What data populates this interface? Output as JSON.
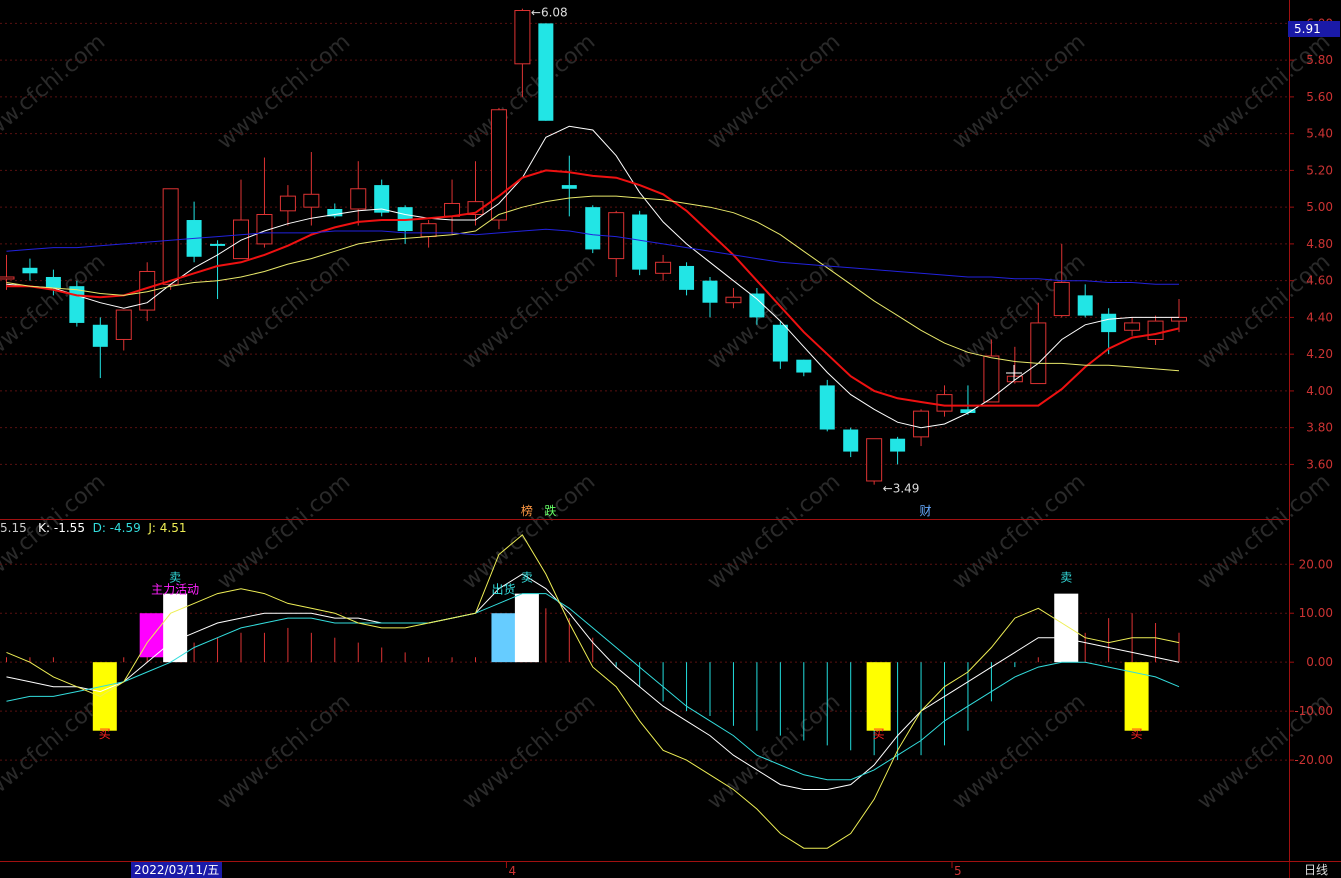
{
  "chart_data": [
    {
      "type": "candlestick",
      "panel": "main",
      "ylim": [
        3.45,
        6.1
      ],
      "y_ticks": [
        "6.00",
        "5.80",
        "5.60",
        "5.40",
        "5.20",
        "5.00",
        "4.80",
        "4.60",
        "4.40",
        "4.20",
        "4.00",
        "3.80",
        "3.60"
      ],
      "last_price": "5.91",
      "candles": [
        {
          "o": 4.62,
          "h": 4.74,
          "l": 4.55,
          "c": 4.62
        },
        {
          "o": 4.67,
          "h": 4.72,
          "l": 4.6,
          "c": 4.64
        },
        {
          "o": 4.62,
          "h": 4.66,
          "l": 4.52,
          "c": 4.56
        },
        {
          "o": 4.57,
          "h": 4.6,
          "l": 4.35,
          "c": 4.37
        },
        {
          "o": 4.36,
          "h": 4.4,
          "l": 4.07,
          "c": 4.24
        },
        {
          "o": 4.28,
          "h": 4.44,
          "l": 4.22,
          "c": 4.44
        },
        {
          "o": 4.44,
          "h": 4.7,
          "l": 4.38,
          "c": 4.65
        },
        {
          "o": 4.58,
          "h": 5.1,
          "l": 4.55,
          "c": 5.1
        },
        {
          "o": 4.93,
          "h": 5.03,
          "l": 4.7,
          "c": 4.73
        },
        {
          "o": 4.8,
          "h": 4.82,
          "l": 4.5,
          "c": 4.79
        },
        {
          "o": 4.72,
          "h": 5.15,
          "l": 4.72,
          "c": 4.93
        },
        {
          "o": 4.8,
          "h": 5.27,
          "l": 4.78,
          "c": 4.96
        },
        {
          "o": 4.98,
          "h": 5.12,
          "l": 4.9,
          "c": 5.06
        },
        {
          "o": 5.0,
          "h": 5.3,
          "l": 4.9,
          "c": 5.07
        },
        {
          "o": 4.99,
          "h": 5.02,
          "l": 4.94,
          "c": 4.95
        },
        {
          "o": 4.99,
          "h": 5.25,
          "l": 4.9,
          "c": 5.1
        },
        {
          "o": 5.12,
          "h": 5.15,
          "l": 4.95,
          "c": 4.97
        },
        {
          "o": 5.0,
          "h": 5.01,
          "l": 4.8,
          "c": 4.87
        },
        {
          "o": 4.84,
          "h": 4.93,
          "l": 4.78,
          "c": 4.91
        },
        {
          "o": 4.95,
          "h": 5.15,
          "l": 4.85,
          "c": 5.02
        },
        {
          "o": 4.96,
          "h": 5.25,
          "l": 4.9,
          "c": 5.03
        },
        {
          "o": 4.93,
          "h": 5.54,
          "l": 4.88,
          "c": 5.53
        },
        {
          "o": 5.78,
          "h": 6.08,
          "l": 5.6,
          "c": 6.07
        },
        {
          "o": 6.0,
          "h": 6.0,
          "l": 5.47,
          "c": 5.47
        },
        {
          "o": 5.12,
          "h": 5.28,
          "l": 4.95,
          "c": 5.1
        },
        {
          "o": 5.0,
          "h": 5.01,
          "l": 4.75,
          "c": 4.77
        },
        {
          "o": 4.72,
          "h": 4.98,
          "l": 4.62,
          "c": 4.97
        },
        {
          "o": 4.96,
          "h": 4.98,
          "l": 4.63,
          "c": 4.66
        },
        {
          "o": 4.64,
          "h": 4.74,
          "l": 4.6,
          "c": 4.7
        },
        {
          "o": 4.68,
          "h": 4.7,
          "l": 4.52,
          "c": 4.55
        },
        {
          "o": 4.6,
          "h": 4.62,
          "l": 4.4,
          "c": 4.48
        },
        {
          "o": 4.48,
          "h": 4.56,
          "l": 4.45,
          "c": 4.51
        },
        {
          "o": 4.53,
          "h": 4.56,
          "l": 4.36,
          "c": 4.4
        },
        {
          "o": 4.36,
          "h": 4.38,
          "l": 4.12,
          "c": 4.16
        },
        {
          "o": 4.17,
          "h": 4.17,
          "l": 4.08,
          "c": 4.1
        },
        {
          "o": 4.03,
          "h": 4.06,
          "l": 3.78,
          "c": 3.79
        },
        {
          "o": 3.79,
          "h": 3.8,
          "l": 3.64,
          "c": 3.67
        },
        {
          "o": 3.51,
          "h": 3.74,
          "l": 3.49,
          "c": 3.74
        },
        {
          "o": 3.74,
          "h": 3.75,
          "l": 3.6,
          "c": 3.67
        },
        {
          "o": 3.75,
          "h": 3.9,
          "l": 3.7,
          "c": 3.89
        },
        {
          "o": 3.89,
          "h": 4.03,
          "l": 3.86,
          "c": 3.98
        },
        {
          "o": 3.9,
          "h": 4.03,
          "l": 3.87,
          "c": 3.88
        },
        {
          "o": 3.94,
          "h": 4.28,
          "l": 3.94,
          "c": 4.19
        },
        {
          "o": 4.05,
          "h": 4.24,
          "l": 4.04,
          "c": 4.08
        },
        {
          "o": 4.04,
          "h": 4.48,
          "l": 4.04,
          "c": 4.37
        },
        {
          "o": 4.41,
          "h": 4.8,
          "l": 4.4,
          "c": 4.59
        },
        {
          "o": 4.52,
          "h": 4.58,
          "l": 4.4,
          "c": 4.41
        },
        {
          "o": 4.42,
          "h": 4.45,
          "l": 4.2,
          "c": 4.32
        },
        {
          "o": 4.33,
          "h": 4.4,
          "l": 4.3,
          "c": 4.37
        },
        {
          "o": 4.28,
          "h": 4.41,
          "l": 4.25,
          "c": 4.38
        },
        {
          "o": 4.38,
          "h": 4.5,
          "l": 4.32,
          "c": 4.4
        }
      ],
      "lines": [
        {
          "name": "ma_white",
          "color": "#ffffff",
          "width": 1,
          "values": [
            4.58,
            4.57,
            4.56,
            4.52,
            4.48,
            4.45,
            4.48,
            4.58,
            4.67,
            4.74,
            4.82,
            4.87,
            4.91,
            4.94,
            4.96,
            4.98,
            4.99,
            4.96,
            4.94,
            4.93,
            4.93,
            5.02,
            5.16,
            5.38,
            5.44,
            5.42,
            5.28,
            5.08,
            4.92,
            4.8,
            4.7,
            4.6,
            4.5,
            4.38,
            4.24,
            4.1,
            3.98,
            3.9,
            3.83,
            3.8,
            3.82,
            3.88,
            3.96,
            4.06,
            4.15,
            4.28,
            4.36,
            4.39,
            4.4,
            4.4,
            4.4
          ]
        },
        {
          "name": "ma_red",
          "color": "#ee1111",
          "width": 2,
          "values": [
            4.57,
            4.57,
            4.55,
            4.52,
            4.51,
            4.52,
            4.56,
            4.6,
            4.64,
            4.68,
            4.7,
            4.74,
            4.79,
            4.85,
            4.89,
            4.92,
            4.93,
            4.93,
            4.94,
            4.95,
            4.97,
            5.06,
            5.16,
            5.2,
            5.19,
            5.17,
            5.16,
            5.12,
            5.07,
            4.98,
            4.86,
            4.74,
            4.6,
            4.46,
            4.32,
            4.2,
            4.08,
            4.0,
            3.96,
            3.94,
            3.92,
            3.92,
            3.92,
            3.92,
            3.92,
            4.01,
            4.13,
            4.23,
            4.29,
            4.31,
            4.34
          ]
        },
        {
          "name": "ma_yellow",
          "color": "#e8e86a",
          "width": 1,
          "values": [
            4.59,
            4.57,
            4.56,
            4.55,
            4.53,
            4.52,
            4.54,
            4.57,
            4.59,
            4.6,
            4.62,
            4.65,
            4.69,
            4.72,
            4.76,
            4.8,
            4.82,
            4.83,
            4.84,
            4.85,
            4.87,
            4.96,
            5.0,
            5.03,
            5.05,
            5.06,
            5.06,
            5.05,
            5.04,
            5.02,
            5.0,
            4.97,
            4.92,
            4.85,
            4.76,
            4.67,
            4.58,
            4.49,
            4.41,
            4.33,
            4.26,
            4.21,
            4.18,
            4.16,
            4.15,
            4.15,
            4.14,
            4.14,
            4.13,
            4.12,
            4.11
          ]
        },
        {
          "name": "ma_blue",
          "color": "#2222dd",
          "width": 1,
          "values": [
            4.76,
            4.77,
            4.78,
            4.78,
            4.79,
            4.8,
            4.81,
            4.82,
            4.83,
            4.84,
            4.85,
            4.86,
            4.86,
            4.86,
            4.87,
            4.87,
            4.87,
            4.86,
            4.86,
            4.86,
            4.85,
            4.86,
            4.87,
            4.88,
            4.87,
            4.85,
            4.84,
            4.82,
            4.8,
            4.78,
            4.76,
            4.74,
            4.72,
            4.7,
            4.69,
            4.68,
            4.67,
            4.66,
            4.65,
            4.64,
            4.63,
            4.62,
            4.62,
            4.61,
            4.61,
            4.6,
            4.6,
            4.59,
            4.59,
            4.58,
            4.58
          ]
        }
      ],
      "annotations": [
        {
          "label": "6.08",
          "kind": "high",
          "index": 22,
          "value": 6.08
        },
        {
          "label": "3.49",
          "kind": "low",
          "index": 37,
          "value": 3.49
        }
      ],
      "event_markers": [
        {
          "label": "榜",
          "index": 22,
          "color": "#ff9944"
        },
        {
          "label": "跌",
          "index": 23,
          "color": "#66ff66"
        },
        {
          "label": "财",
          "index": 39,
          "color": "#66aaff"
        }
      ]
    },
    {
      "type": "indicator",
      "panel": "kdj",
      "ylim": [
        -40,
        27
      ],
      "y_ticks": [
        "20.00",
        "10.00",
        "0.00",
        "-10.00",
        "-20.00"
      ],
      "legend": [
        {
          "text": "5.15",
          "color": "#cccccc"
        },
        {
          "text": "K: -1.55",
          "color": "#ffffff"
        },
        {
          "text": "D: -4.59",
          "color": "#33dddd"
        },
        {
          "text": "J: 4.51",
          "color": "#eeee55"
        }
      ],
      "histogram": [
        1,
        1,
        1,
        0,
        0,
        1,
        2,
        3,
        4,
        5,
        6,
        6,
        7,
        6,
        5,
        4,
        3,
        2,
        1,
        1,
        1,
        2,
        8,
        11,
        9,
        5,
        -1,
        -5,
        -8,
        -10,
        -11,
        -13,
        -14,
        -15,
        -16,
        -17,
        -18,
        -19,
        -20,
        -19,
        -17,
        -14,
        -8,
        -1,
        1,
        3,
        6,
        9,
        10,
        8,
        6
      ],
      "lines": [
        {
          "name": "K",
          "color": "#ffffff",
          "values": [
            -3,
            -4,
            -5,
            -5,
            -6,
            -4,
            0,
            4,
            6,
            8,
            9,
            10,
            10,
            10,
            9,
            9,
            8,
            8,
            8,
            9,
            10,
            15,
            18,
            15,
            10,
            4,
            -1,
            -5,
            -9,
            -12,
            -15,
            -19,
            -22,
            -25,
            -26,
            -26,
            -25,
            -21,
            -15,
            -10,
            -7,
            -4,
            -1,
            2,
            5,
            5,
            4,
            3,
            2,
            1,
            0
          ]
        },
        {
          "name": "D",
          "color": "#33dddd",
          "values": [
            -8,
            -7,
            -7,
            -6,
            -5,
            -4,
            -2,
            0,
            3,
            5,
            7,
            8,
            9,
            9,
            8,
            8,
            8,
            8,
            8,
            9,
            10,
            12,
            14,
            14,
            11,
            7,
            3,
            -1,
            -5,
            -9,
            -12,
            -15,
            -19,
            -21,
            -23,
            -24,
            -24,
            -22,
            -19,
            -16,
            -12,
            -9,
            -6,
            -3,
            -1,
            0,
            0,
            -1,
            -2,
            -3,
            -5
          ]
        },
        {
          "name": "J",
          "color": "#eeee55",
          "values": [
            2,
            0,
            -3,
            -5,
            -7,
            -4,
            4,
            10,
            12,
            14,
            15,
            14,
            12,
            11,
            10,
            8,
            7,
            7,
            8,
            9,
            10,
            22,
            26,
            18,
            8,
            -1,
            -5,
            -12,
            -18,
            -20,
            -23,
            -26,
            -30,
            -35,
            -38,
            -38,
            -35,
            -28,
            -18,
            -10,
            -5,
            -2,
            3,
            9,
            11,
            8,
            5,
            4,
            5,
            5,
            4
          ]
        }
      ],
      "signal_bars": [
        {
          "index": 4,
          "from": 0,
          "to": -14,
          "color": "#ffff00"
        },
        {
          "index": 6,
          "from": 1,
          "to": 10,
          "color": "#ff00ff"
        },
        {
          "index": 7,
          "from": 0,
          "to": 14,
          "color": "#ffffff"
        },
        {
          "index": 21,
          "from": 0,
          "to": 10,
          "color": "#66ccff"
        },
        {
          "index": 22,
          "from": 0,
          "to": 14,
          "color": "#ffffff"
        },
        {
          "index": 37,
          "from": 0,
          "to": -14,
          "color": "#ffff00"
        },
        {
          "index": 45,
          "from": 0,
          "to": 14,
          "color": "#ffffff"
        },
        {
          "index": 48,
          "from": 0,
          "to": -14,
          "color": "#ffff00"
        }
      ],
      "signal_labels": [
        {
          "text": "买",
          "index": 4,
          "value": -14.5,
          "color": "#ff2222"
        },
        {
          "text": "卖",
          "index": 7,
          "value": 17.5,
          "color": "#33dddd"
        },
        {
          "text": "主力活动",
          "index": 7,
          "value": 15,
          "color": "#ff22ff"
        },
        {
          "text": "卖",
          "index": 22,
          "value": 17.5,
          "color": "#33dddd"
        },
        {
          "text": "出货",
          "index": 21,
          "value": 15,
          "color": "#33dddd"
        },
        {
          "text": "买",
          "index": 37,
          "value": -14.5,
          "color": "#ff2222"
        },
        {
          "text": "卖",
          "index": 45,
          "value": 17.5,
          "color": "#33dddd"
        },
        {
          "text": "买",
          "index": 48,
          "value": -14.5,
          "color": "#ff2222"
        }
      ]
    }
  ],
  "x_axis": {
    "date_label": "2022/03/11/五",
    "month_ticks": [
      {
        "label": "4",
        "index": 21
      },
      {
        "label": "5",
        "index": 40
      }
    ],
    "period_label": "日线"
  },
  "watermark": "www.cfchi.com"
}
